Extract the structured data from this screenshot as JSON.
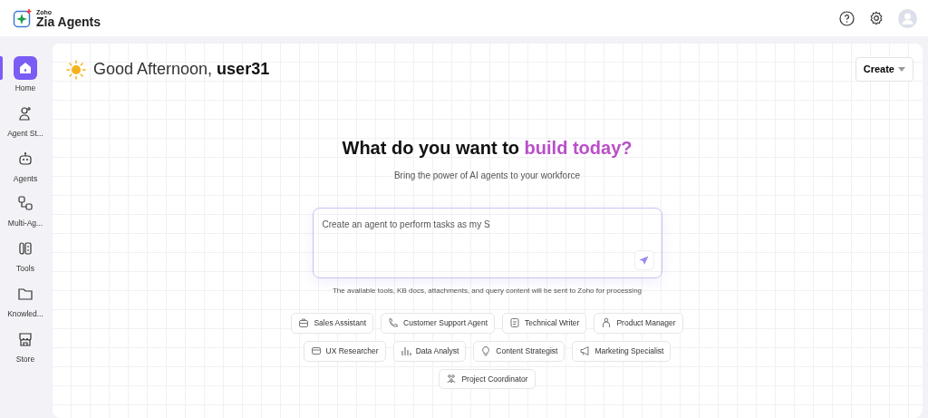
{
  "brand": {
    "company": "Zoho",
    "product": "Zia Agents"
  },
  "sidebar": {
    "items": [
      {
        "label": "Home",
        "selected": true
      },
      {
        "label": "Agent St...",
        "selected": false
      },
      {
        "label": "Agents",
        "selected": false
      },
      {
        "label": "Multi-Ag...",
        "selected": false
      },
      {
        "label": "Tools",
        "selected": false
      },
      {
        "label": "Knowled...",
        "selected": false
      },
      {
        "label": "Store",
        "selected": false
      }
    ]
  },
  "greeting": {
    "text": "Good Afternoon,",
    "user": "user31"
  },
  "create_button": "Create",
  "hero": {
    "title": "What do you want to",
    "highlight": "build today?",
    "subtitle": "Bring the power of AI agents to your workforce"
  },
  "prompt": {
    "placeholder": "Create an agent to perform tasks as my S",
    "notice": "The available tools, KB docs, attachments, and query content will be sent to Zoho for processing"
  },
  "suggestions": [
    [
      "Sales Assistant",
      "Customer Support Agent",
      "Technical Writer",
      "Product Manager"
    ],
    [
      "UX Researcher",
      "Data Analyst",
      "Content Strategist",
      "Marketing Specialist"
    ],
    [
      "Project Coordinator"
    ]
  ]
}
